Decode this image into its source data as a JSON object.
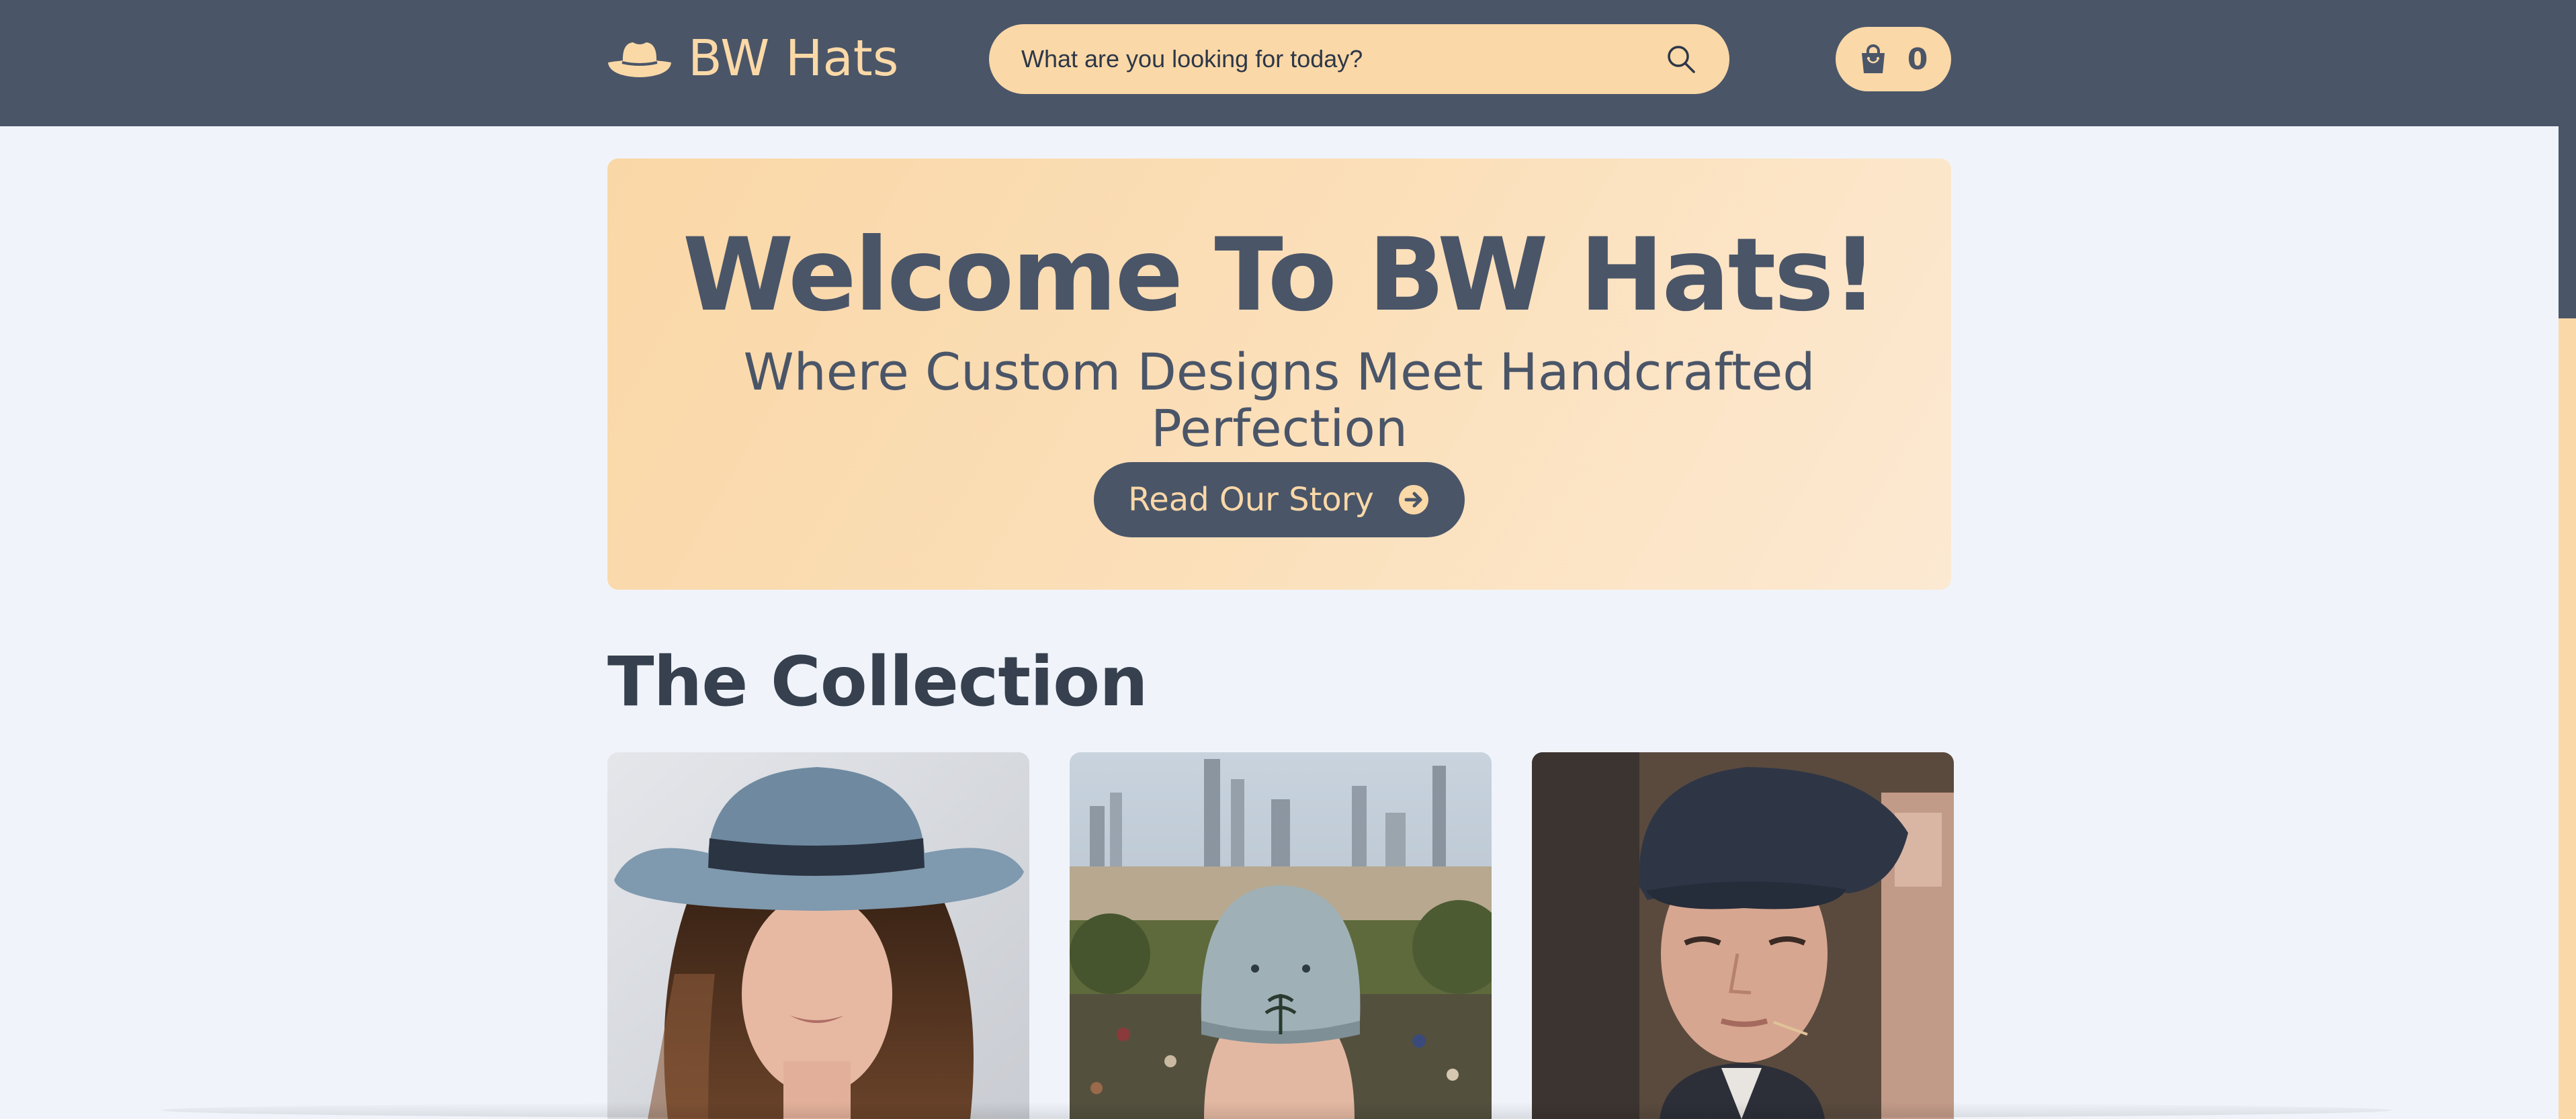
{
  "header": {
    "logo_text": "BW Hats",
    "logo_icon": "hat-icon",
    "search": {
      "placeholder": "What are you looking for today?",
      "value": "",
      "icon": "search-icon"
    },
    "cart": {
      "icon": "shopping-bag-icon",
      "count": "0"
    }
  },
  "hero": {
    "title": "Welcome To BW Hats!",
    "subtitle": "Where Custom Designs Meet Handcrafted Perfection",
    "button_label": "Read Our Story",
    "button_icon": "arrow-right-circle-icon"
  },
  "collection": {
    "title": "The Collection",
    "items": [
      {
        "image": "woman-in-blue-fedora"
      },
      {
        "image": "person-in-grey-baseball-cap-facing-city"
      },
      {
        "image": "young-man-in-dark-flat-cap"
      }
    ]
  },
  "colors": {
    "header_bg": "#4a5568",
    "accent": "#fad8a7",
    "page_bg": "#f0f4fa",
    "heading": "#4a5568"
  }
}
